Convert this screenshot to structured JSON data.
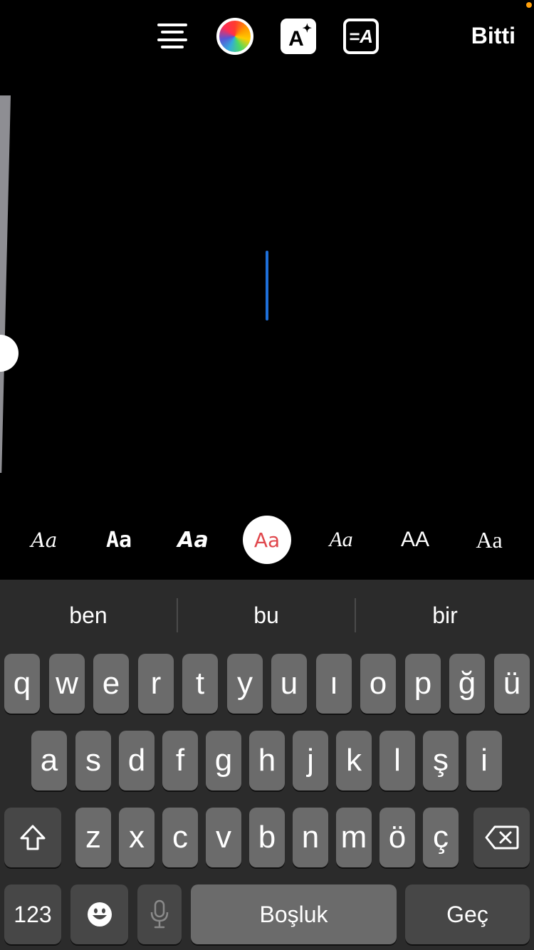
{
  "toolbar": {
    "align_icon": "align-center-icon",
    "color_icon": "color-wheel-icon",
    "effect_icon": "text-effect-icon",
    "effect_letter": "A",
    "effect_sparkle": "✦",
    "style_icon": "text-background-icon",
    "style_glyph": "=A",
    "done_label": "Bitti"
  },
  "fonts": [
    {
      "label": "Aa",
      "style": "script"
    },
    {
      "label": "Aa",
      "style": "bold-mono"
    },
    {
      "label": "Aa",
      "style": "bold-italic"
    },
    {
      "label": "Aa",
      "style": "rounded",
      "selected": true
    },
    {
      "label": "Aa",
      "style": "italic-serif"
    },
    {
      "label": "AA",
      "style": "caps"
    },
    {
      "label": "Aa",
      "style": "serif"
    }
  ],
  "colors": {
    "cursor": "#1e6fd9",
    "selected_font": "#e0474c",
    "status_dot": "#ff9f0a"
  },
  "keyboard": {
    "suggestions": [
      "ben",
      "bu",
      "bir"
    ],
    "row1": [
      "q",
      "w",
      "e",
      "r",
      "t",
      "y",
      "u",
      "ı",
      "o",
      "p",
      "ğ",
      "ü"
    ],
    "row2": [
      "a",
      "s",
      "d",
      "f",
      "g",
      "h",
      "j",
      "k",
      "l",
      "ş",
      "i"
    ],
    "row3": [
      "z",
      "x",
      "c",
      "v",
      "b",
      "n",
      "m",
      "ö",
      "ç"
    ],
    "shift_icon": "shift-icon",
    "backspace_icon": "backspace-icon",
    "numbers_label": "123",
    "emoji_icon": "emoji-icon",
    "mic_icon": "microphone-icon",
    "space_label": "Boşluk",
    "return_label": "Geç"
  }
}
